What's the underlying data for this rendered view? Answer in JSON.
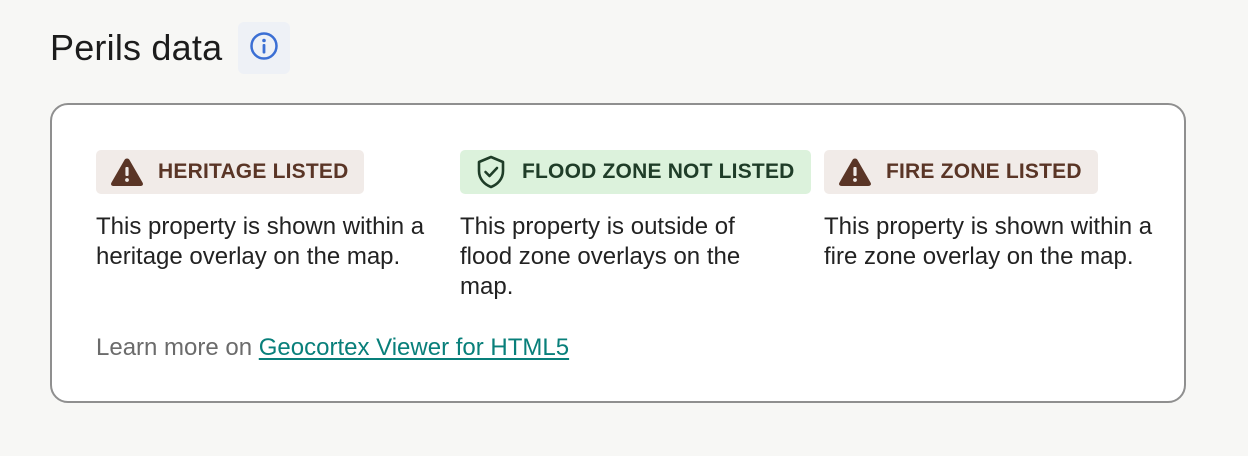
{
  "header": {
    "title": "Perils data",
    "info_icon": "info-circle-icon"
  },
  "perils": [
    {
      "status": "warning",
      "icon": "warning-triangle-icon",
      "badge": "HERITAGE LISTED",
      "description": "This property is shown within a heritage overlay on the map."
    },
    {
      "status": "ok",
      "icon": "shield-check-icon",
      "badge": "FLOOD ZONE NOT LISTED",
      "description": "This property is outside of flood zone overlays on the map."
    },
    {
      "status": "warning",
      "icon": "warning-triangle-icon",
      "badge": "FIRE ZONE LISTED",
      "description": "This property is shown within a fire zone overlay on the map."
    }
  ],
  "learn_more": {
    "prefix": "Learn more on",
    "link_text": "Geocortex Viewer for HTML5"
  },
  "colors": {
    "warning_badge_bg": "#f1ebe8",
    "warning_text": "#5a3526",
    "ok_badge_bg": "#dcf2dc",
    "ok_text": "#1f3d28",
    "link": "#087f7a",
    "info_icon": "#3b6fd4"
  }
}
